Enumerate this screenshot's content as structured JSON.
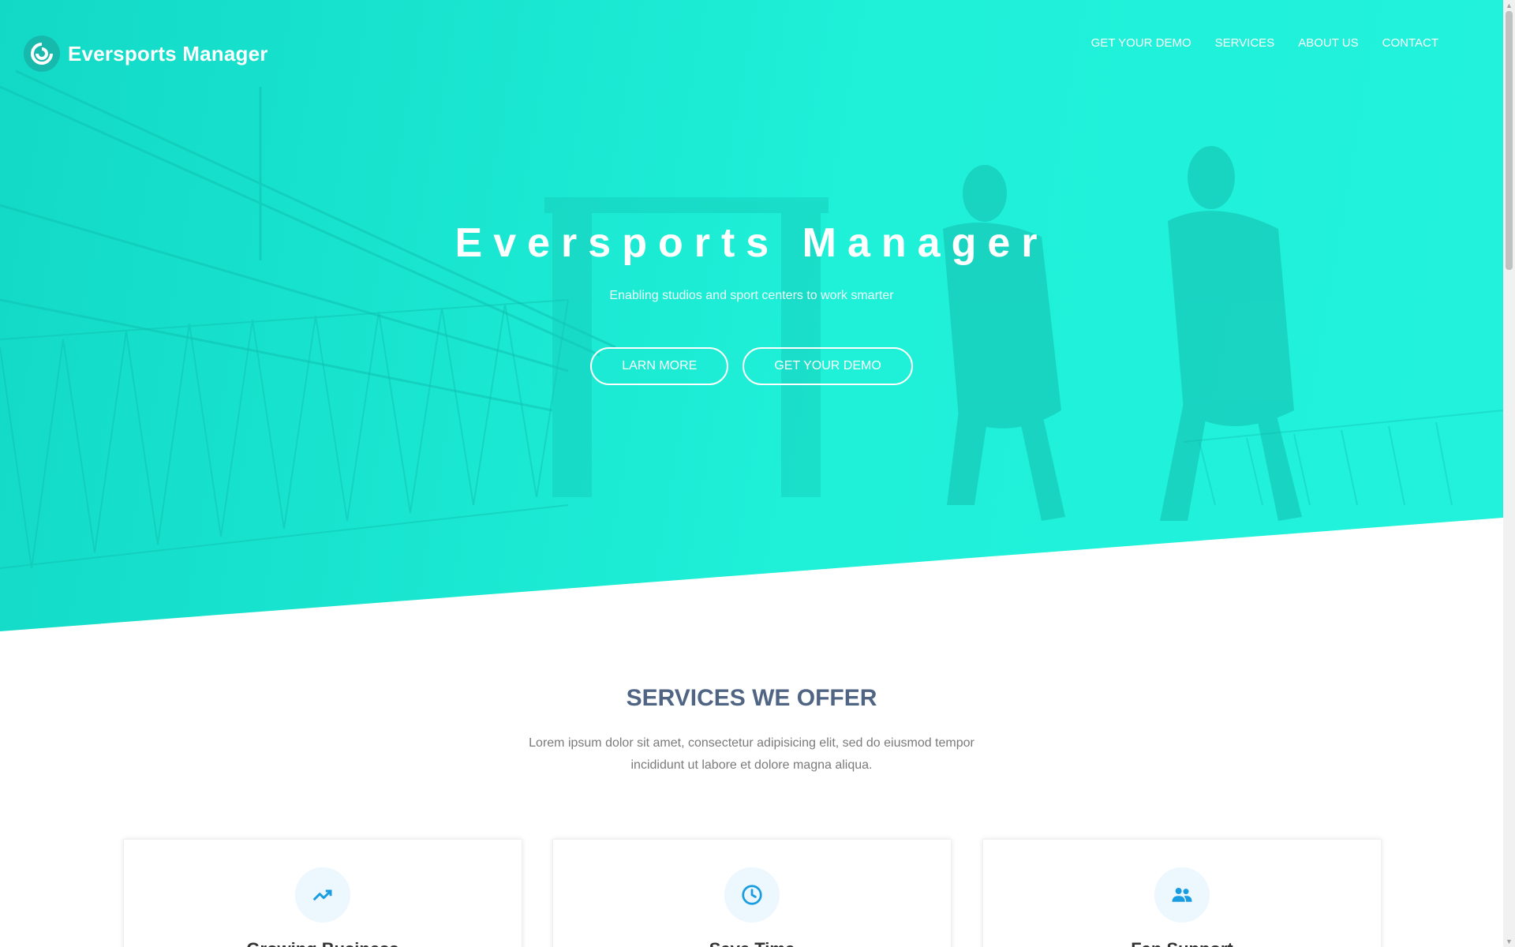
{
  "brand": {
    "name": "Eversports Manager",
    "logo_icon": "swirl-logo-icon"
  },
  "nav": {
    "items": [
      {
        "label": "GET YOUR DEMO"
      },
      {
        "label": "SERVICES"
      },
      {
        "label": "ABOUT US"
      },
      {
        "label": "CONTACT"
      }
    ]
  },
  "hero": {
    "title": "Eversports Manager",
    "subtitle": "Enabling studios and sport centers to work smarter",
    "buttons": [
      {
        "label": "LARN MORE"
      },
      {
        "label": "GET YOUR DEMO"
      }
    ],
    "accent": "#1ff0d8"
  },
  "services": {
    "title": "SERVICES WE OFFER",
    "description": "Lorem ipsum dolor sit amet, consectetur adipisicing elit, sed do eiusmod tempor incididunt ut labore et dolore magna aliqua.",
    "cards": [
      {
        "icon": "trending-up-icon",
        "title": "Growing Business"
      },
      {
        "icon": "clock-icon",
        "title": "Save Time"
      },
      {
        "icon": "people-icon",
        "title": "Fan Support"
      }
    ],
    "icon_color": "#1a9de0"
  }
}
